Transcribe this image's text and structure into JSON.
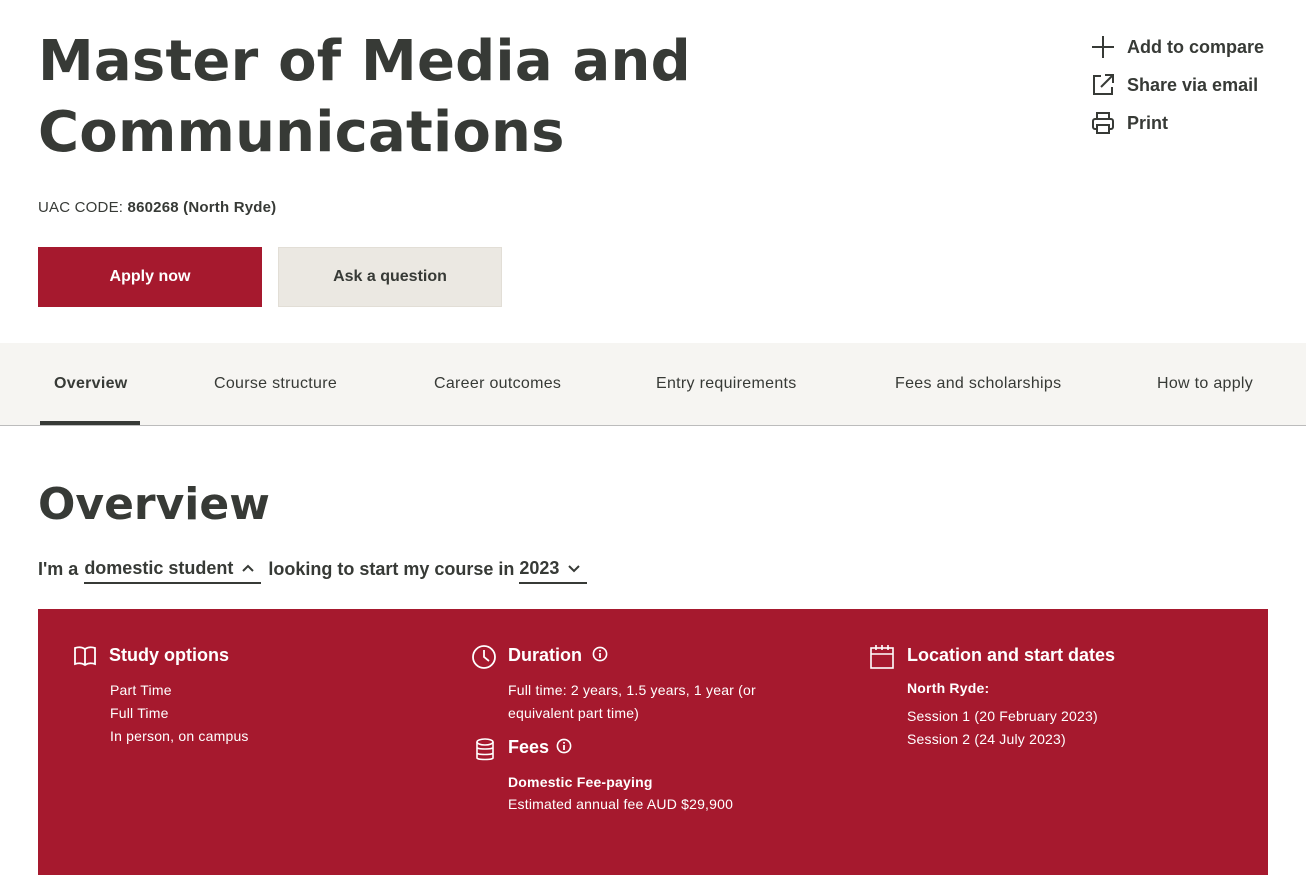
{
  "header": {
    "title_line1": "Master of Media and",
    "title_line2": "Communications",
    "uac_label": "UAC CODE:",
    "uac_value": "860268 (North Ryde)"
  },
  "actions": [
    {
      "label": "Add to compare",
      "icon": "plus-icon"
    },
    {
      "label": "Share via email",
      "icon": "external-link-icon"
    },
    {
      "label": "Print",
      "icon": "printer-icon"
    }
  ],
  "buttons": {
    "apply": "Apply now",
    "ask": "Ask a question"
  },
  "tabs": [
    {
      "label": "Overview",
      "active": true
    },
    {
      "label": "Course structure",
      "active": false
    },
    {
      "label": "Career outcomes",
      "active": false
    },
    {
      "label": "Entry requirements",
      "active": false
    },
    {
      "label": "Fees and scholarships",
      "active": false
    },
    {
      "label": "How to apply",
      "active": false
    }
  ],
  "overview": {
    "heading": "Overview",
    "sentence_prefix": "I'm a",
    "student_type": "domestic student",
    "sentence_middle": "looking to start my course in",
    "year": "2023"
  },
  "panel": {
    "study_options": {
      "title": "Study options",
      "items": [
        "Part Time",
        "Full Time",
        "In person, on campus"
      ]
    },
    "duration": {
      "title": "Duration",
      "line1": "Full time: 2 years, 1.5 years, 1 year (or",
      "line2": "equivalent part time)"
    },
    "fees": {
      "title": "Fees",
      "type": "Domestic Fee-paying",
      "estimate": "Estimated annual fee AUD $29,900"
    },
    "location": {
      "title": "Location and start dates",
      "campus": "North Ryde:",
      "sessions": [
        "Session 1 (20 February 2023)",
        "Session 2 (24 July 2023)"
      ]
    }
  },
  "colors": {
    "brand_red": "#a6192e",
    "text_dark": "#373a36",
    "tab_bar_bg": "#f6f5f2",
    "secondary_button_bg": "#ebe8e2"
  }
}
